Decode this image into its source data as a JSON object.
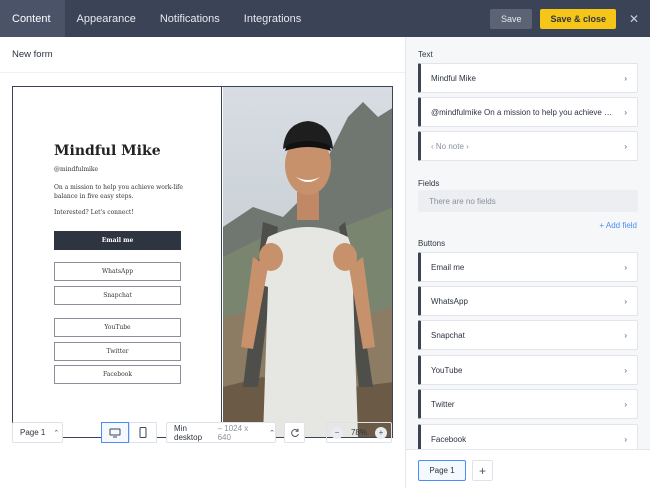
{
  "topbar": {
    "tabs": [
      {
        "label": "Content",
        "active": true
      },
      {
        "label": "Appearance",
        "active": false
      },
      {
        "label": "Notifications",
        "active": false
      },
      {
        "label": "Integrations",
        "active": false
      }
    ],
    "save_label": "Save",
    "save_close_label": "Save & close",
    "close_glyph": "✕",
    "accent_color": "#f5c518"
  },
  "form": {
    "name": "New form"
  },
  "preview": {
    "title": "Mindful Mike",
    "handle": "@mindfulmike",
    "bio": "On a mission to help you achieve work-life balance in five easy steps.",
    "cta": "Interested? Let's connect!",
    "primary_button": "Email me",
    "buttons": [
      "WhatsApp",
      "Snapchat",
      "YouTube",
      "Twitter",
      "Facebook"
    ]
  },
  "bottombar": {
    "page_select": "Page 1",
    "size_name": "Min desktop",
    "size_dims": "– 1024 x 640",
    "zoom": "78%",
    "zoom_minus": "−",
    "zoom_plus": "+"
  },
  "sidebar": {
    "text_title": "Text",
    "text_items": [
      "Mindful Mike",
      "@mindfulmike On a mission to help you achieve wor...",
      "‹ No note ›"
    ],
    "fields_title": "Fields",
    "no_fields": "There are no fields",
    "add_field": "+ Add field",
    "buttons_title": "Buttons",
    "button_items": [
      "Email me",
      "WhatsApp",
      "Snapchat",
      "YouTube",
      "Twitter",
      "Facebook"
    ],
    "page_tab": "Page 1",
    "add_page": "+"
  }
}
